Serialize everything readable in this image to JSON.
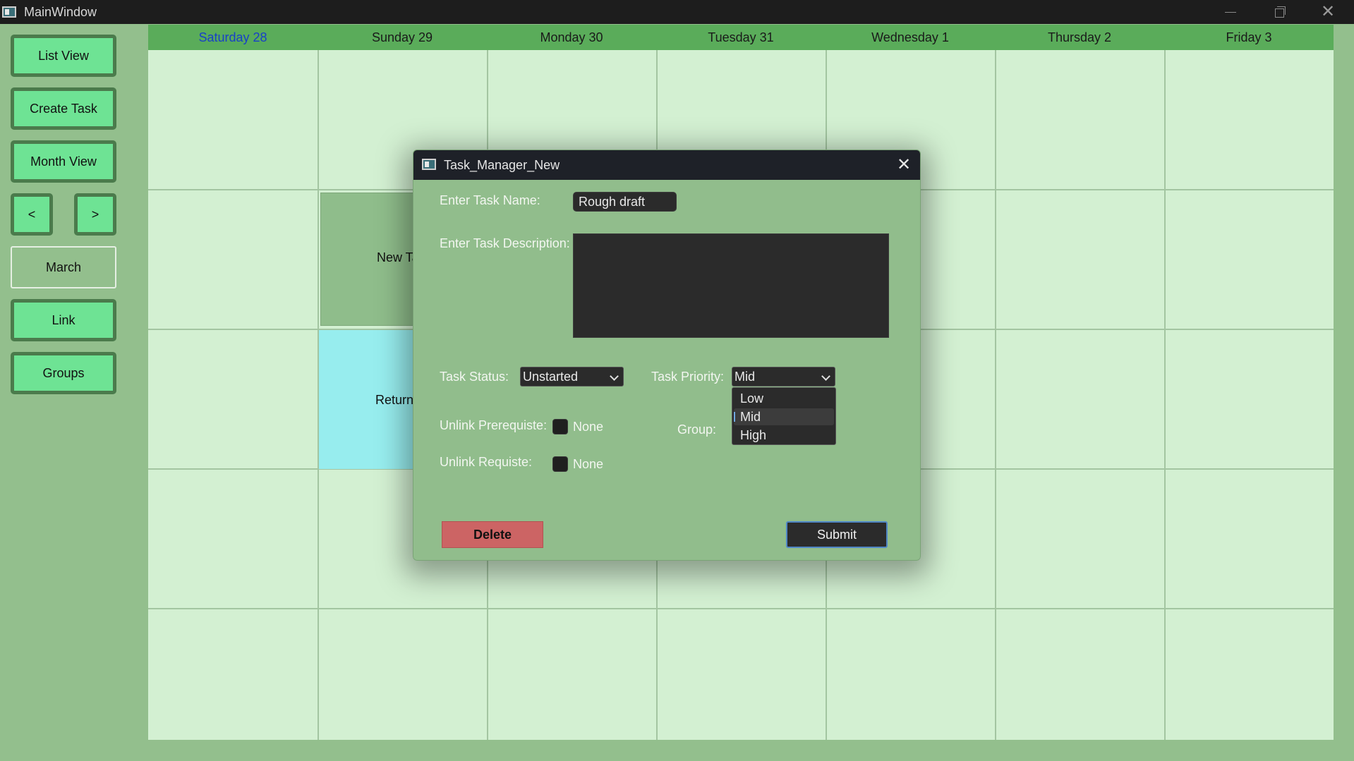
{
  "window": {
    "title": "MainWindow",
    "min_glyph": "",
    "max_glyph": "",
    "close_glyph": "✕"
  },
  "sidebar": {
    "list_view": "List View",
    "create_task": "Create Task",
    "month_view": "Month View",
    "prev": "<",
    "next": ">",
    "month": "March",
    "link": "Link",
    "groups": "Groups"
  },
  "calendar": {
    "days": [
      "Saturday 28",
      "Sunday 29",
      "Monday 30",
      "Tuesday 31",
      "Wednesday 1",
      "Thursday 2",
      "Friday 3"
    ],
    "tasks": [
      {
        "text": "New Ta"
      },
      {
        "text": "Return b"
      }
    ],
    "colors": {
      "header": "#5aac5a",
      "cell": "#d3f0d2",
      "task_new": "#8fbd8b",
      "task_return": "#97edee",
      "today": "#1840c8"
    }
  },
  "dialog": {
    "title": "Task_Manager_New",
    "close_glyph": "✕",
    "name_label": "Enter Task Name:",
    "name_value": "Rough draft",
    "desc_label": "Enter Task Description:",
    "desc_value": "",
    "status_label": "Task Status:",
    "status_value": "Unstarted",
    "priority_label": "Task Priority:",
    "priority_value": "Mid",
    "priority_options": [
      "Low",
      "Mid",
      "High"
    ],
    "unlink_prereq_label": "Unlink Prerequiste:",
    "unlink_prereq_value": "None",
    "group_label": "Group:",
    "unlink_req_label": "Unlink Requiste:",
    "unlink_req_value": "None",
    "delete_label": "Delete",
    "submit_label": "Submit",
    "colors": {
      "delete": "#cc6464",
      "submit_border": "#4f86c6"
    }
  }
}
